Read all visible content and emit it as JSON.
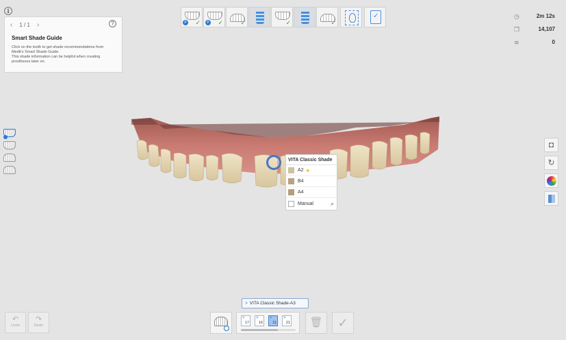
{
  "guide": {
    "page": "1 / 1",
    "prev_icon": "chevron-left-icon",
    "next_icon": "chevron-right-icon",
    "help": "?",
    "title": "Smart Shade Guide",
    "text": [
      "Click on the tooth to get shade recommendations from",
      "Medit's Smart Shade Guide.",
      "This shade information can be helpful when creating",
      "prostheses later on."
    ]
  },
  "info": "i",
  "stages": [
    {
      "icon": "upper-jaw-icon",
      "badge": "P",
      "check": "✓"
    },
    {
      "icon": "upper-jaw-prep-icon",
      "badge": "P",
      "check": "✓"
    },
    {
      "icon": "lower-jaw-icon",
      "check": "✓"
    },
    {
      "icon": "scanbody-icon"
    },
    {
      "icon": "occlusion-icon",
      "check": "✓"
    },
    {
      "icon": "scanbody-active-icon"
    },
    {
      "icon": "bite-icon",
      "check": "✓"
    },
    {
      "icon": "face-scan-icon"
    },
    {
      "icon": "review-icon"
    }
  ],
  "stats": {
    "time": "2m 12s",
    "count": "14,107",
    "wifi": "0"
  },
  "shade_popup": {
    "title": "VITA Classic Shade",
    "options": [
      {
        "label": "A2",
        "color": "#cfc2a2",
        "recommended": true
      },
      {
        "label": "B4",
        "color": "#b8a381"
      },
      {
        "label": "A4",
        "color": "#b29f7c"
      }
    ],
    "manual_label": "Manual"
  },
  "bottom": {
    "undo": "Undo",
    "redo": "Redo",
    "tooltip": "VITA Classic Shade-A3",
    "teeth": [
      {
        "num": "17"
      },
      {
        "num": "16"
      },
      {
        "num": "11",
        "active": true
      },
      {
        "num": "21"
      }
    ]
  }
}
